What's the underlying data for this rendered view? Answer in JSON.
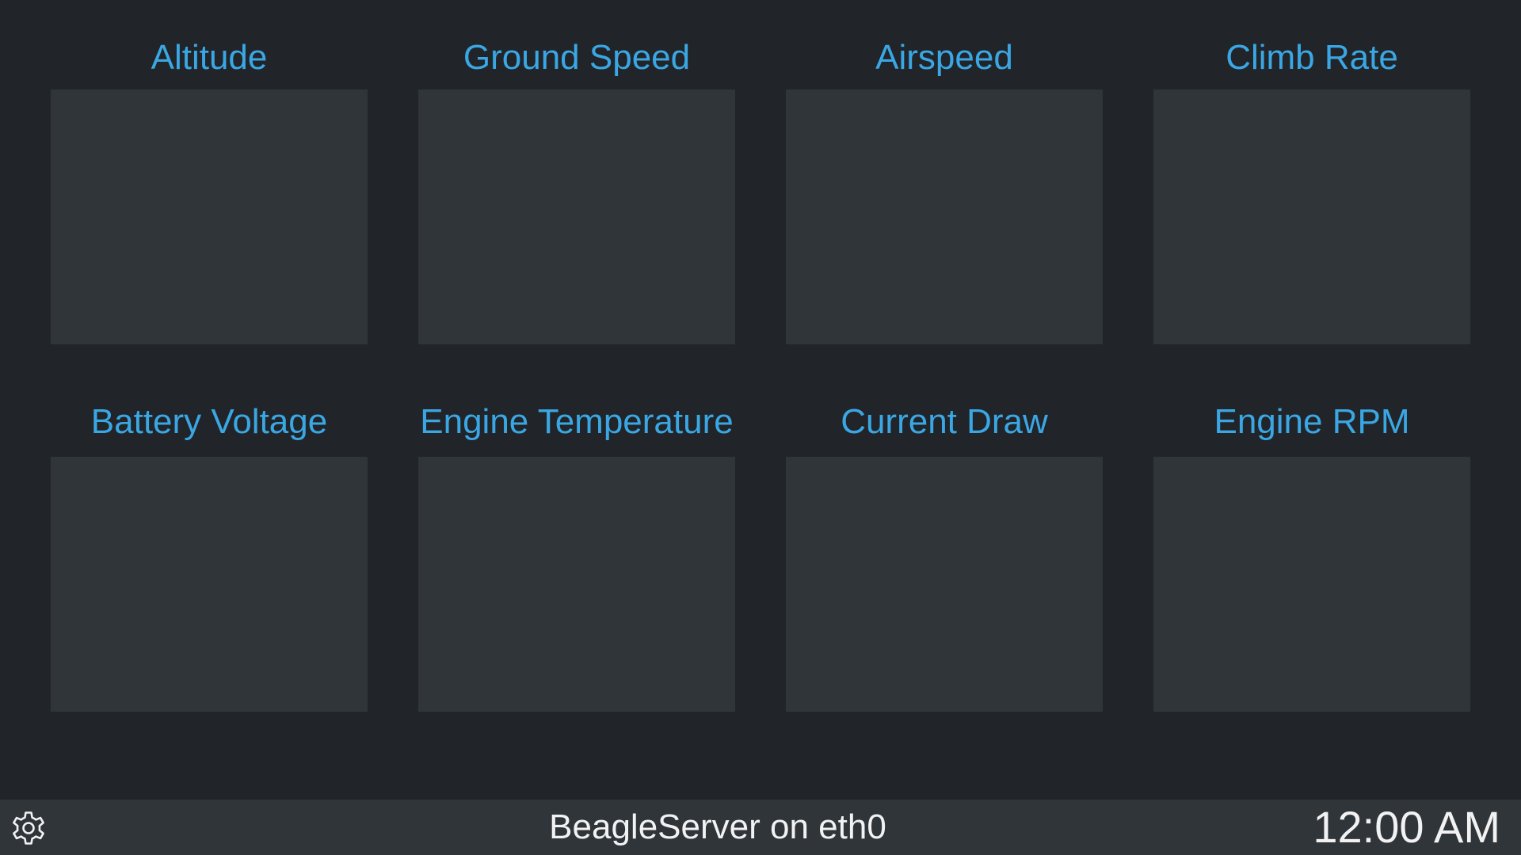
{
  "gauges": [
    {
      "title": "Altitude"
    },
    {
      "title": "Ground Speed"
    },
    {
      "title": "Airspeed"
    },
    {
      "title": "Climb Rate"
    },
    {
      "title": "Battery Voltage"
    },
    {
      "title": "Engine Temperature"
    },
    {
      "title": "Current Draw"
    },
    {
      "title": "Engine RPM"
    }
  ],
  "statusbar": {
    "settings_icon": "gear-icon",
    "server_text": "BeagleServer on eth0",
    "clock": "12:00 AM"
  },
  "colors": {
    "background": "#212428",
    "panel": "#30353a",
    "title_accent": "#3aa7e4",
    "status_text": "#f2f2f2"
  }
}
